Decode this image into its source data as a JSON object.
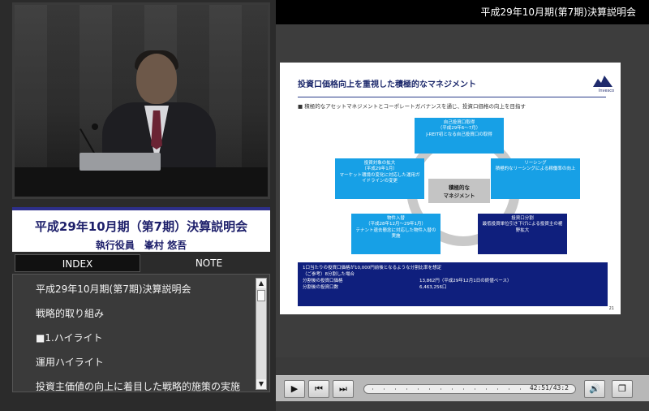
{
  "window": {
    "title": "平成29年10月期(第7期)決算説明会"
  },
  "presenter_caption": {
    "title": "平成29年10月期（第7期）決算説明会",
    "subtitle": "執行役員　峯村 悠吾"
  },
  "tabs": [
    {
      "label": "INDEX",
      "active": true
    },
    {
      "label": "NOTE",
      "active": false
    }
  ],
  "index_items": [
    "平成29年10月期(第7期)決算説明会",
    "戦略的取り組み",
    "■1.ハイライト",
    "運用ハイライト",
    "投資主価値の向上に着目した戦略的施策の実施"
  ],
  "slide": {
    "title": "投資口価格向上を重視した積極的なマネジメント",
    "logo_text": "Invesco",
    "subtitle": "■ 積極的なアセットマネジメントとコーポレートガバナンスを通じ、投資口価格の向上を目指す",
    "center": {
      "line1": "積極的な",
      "line2": "マネジメント"
    },
    "boxes": [
      {
        "title": "自己投資口取得",
        "date": "（平成29年6〜7月）",
        "body": "J-REIT初となる自己投資口の取得"
      },
      {
        "title": "投資対象の拡大",
        "date": "（平成29年1月）",
        "body": "マーケット環境の変化に対応した運用ガイドラインの変更"
      },
      {
        "title": "リーシング",
        "date": "",
        "body": "積極的なリーシングによる稼働率の向上"
      },
      {
        "title": "物件入替",
        "date": "（平成28年12月〜29年1月）",
        "body": "テナント退去懸念に対応した物件入替の実施"
      },
      {
        "title": "投資口分割",
        "date": "",
        "body": "最低投資単位引き下げによる投資主の裾野拡大"
      }
    ],
    "band": {
      "heading": "1口当たりの投資口価格が10,000円前後となるような分割比率を想定",
      "note": "（ご参考）8分割した場合",
      "rows": [
        {
          "label": "分割後の投資口価格",
          "value": "13,862円（平成29年12月1日の終値ベース）"
        },
        {
          "label": "分割後の投資口数",
          "value": "6,463,256口"
        }
      ]
    },
    "page": "21"
  },
  "player": {
    "time": "42:51/43:2",
    "icons": [
      "play-icon",
      "prev-icon",
      "next-icon",
      "volume-icon",
      "popout-icon"
    ]
  }
}
